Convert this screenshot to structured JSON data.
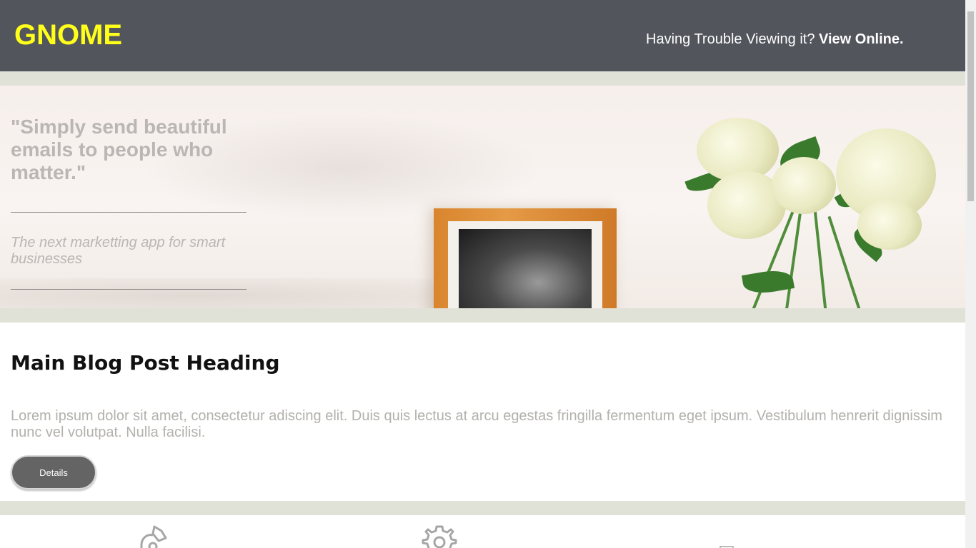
{
  "header": {
    "brand": "GNOME",
    "trouble_text": "Having Trouble Viewing it?",
    "view_online_label": "View Online."
  },
  "hero": {
    "quote": "\"Simply send beautiful emails to people who matter.\"",
    "tagline": "The next marketting app for smart businesses"
  },
  "blog": {
    "heading": "Main Blog Post Heading",
    "body": "Lorem ipsum dolor sit amet, consectetur adiscing elit. Duis quis lectus at arcu egestas fringilla fermentum eget ipsum. Vestibulum henrerit dignissim nunc vel volutpat. Nulla facilisi.",
    "details_label": "Details"
  },
  "features": {
    "icons": [
      "paint-brush-icon",
      "gear-icon",
      "document-icon"
    ]
  },
  "colors": {
    "header_bg": "#53555d",
    "brand": "#ffff1a",
    "separator": "#e1e2d7",
    "button_bg": "#646464"
  }
}
